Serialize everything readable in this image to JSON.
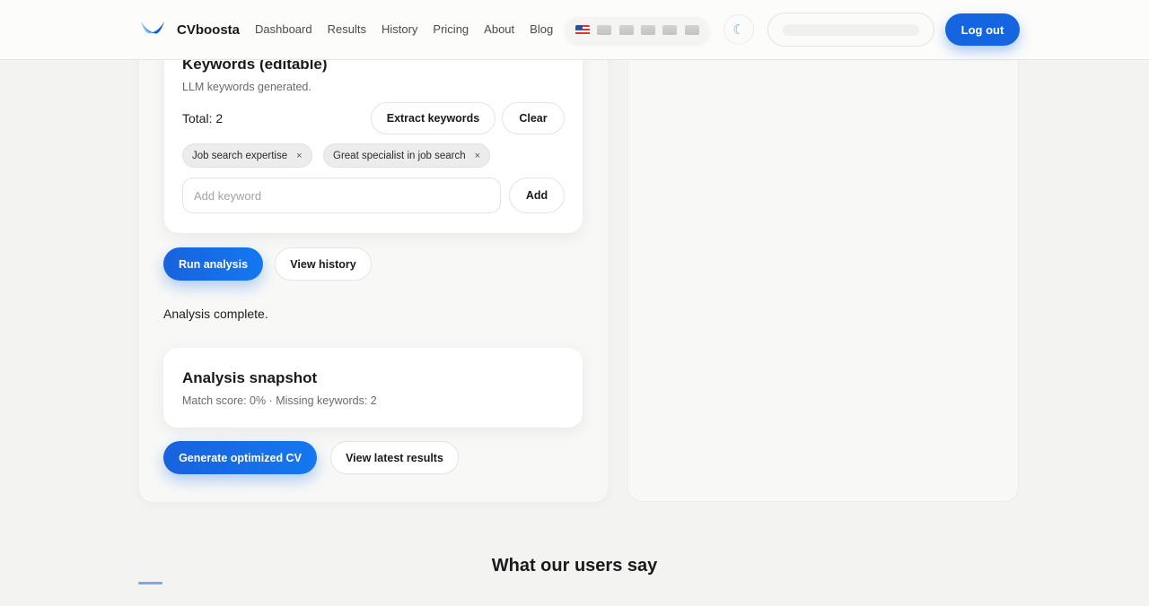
{
  "header": {
    "brand": "CVboosta",
    "nav": [
      "Dashboard",
      "Results",
      "History",
      "Pricing",
      "About",
      "Blog"
    ],
    "flags": [
      "us-flag-icon",
      "flag-icon",
      "flag-icon",
      "flag-icon",
      "flag-icon",
      "flag-icon"
    ],
    "theme_icon": "☾",
    "logout_label": "Log out"
  },
  "keywords": {
    "title": "Keywords (editable)",
    "subtitle": "LLM keywords generated.",
    "total_label": "Total: 2",
    "extract_label": "Extract keywords",
    "clear_label": "Clear",
    "chips": [
      "Job search expertise",
      "Great specialist in job search"
    ],
    "chip_remove": "×",
    "input_placeholder": "Add keyword",
    "input_value": "",
    "add_label": "Add"
  },
  "actions": {
    "run_label": "Run analysis",
    "history_label": "View history"
  },
  "status_text": "Analysis complete.",
  "snapshot": {
    "title": "Analysis snapshot",
    "summary": "Match score: 0% · Missing keywords: 2"
  },
  "results_actions": {
    "generate_label": "Generate optimized CV",
    "latest_label": "View latest results"
  },
  "testimonials_heading": "What our users say",
  "colors": {
    "accent": "#1565e0",
    "background": "#f3f3f2"
  }
}
